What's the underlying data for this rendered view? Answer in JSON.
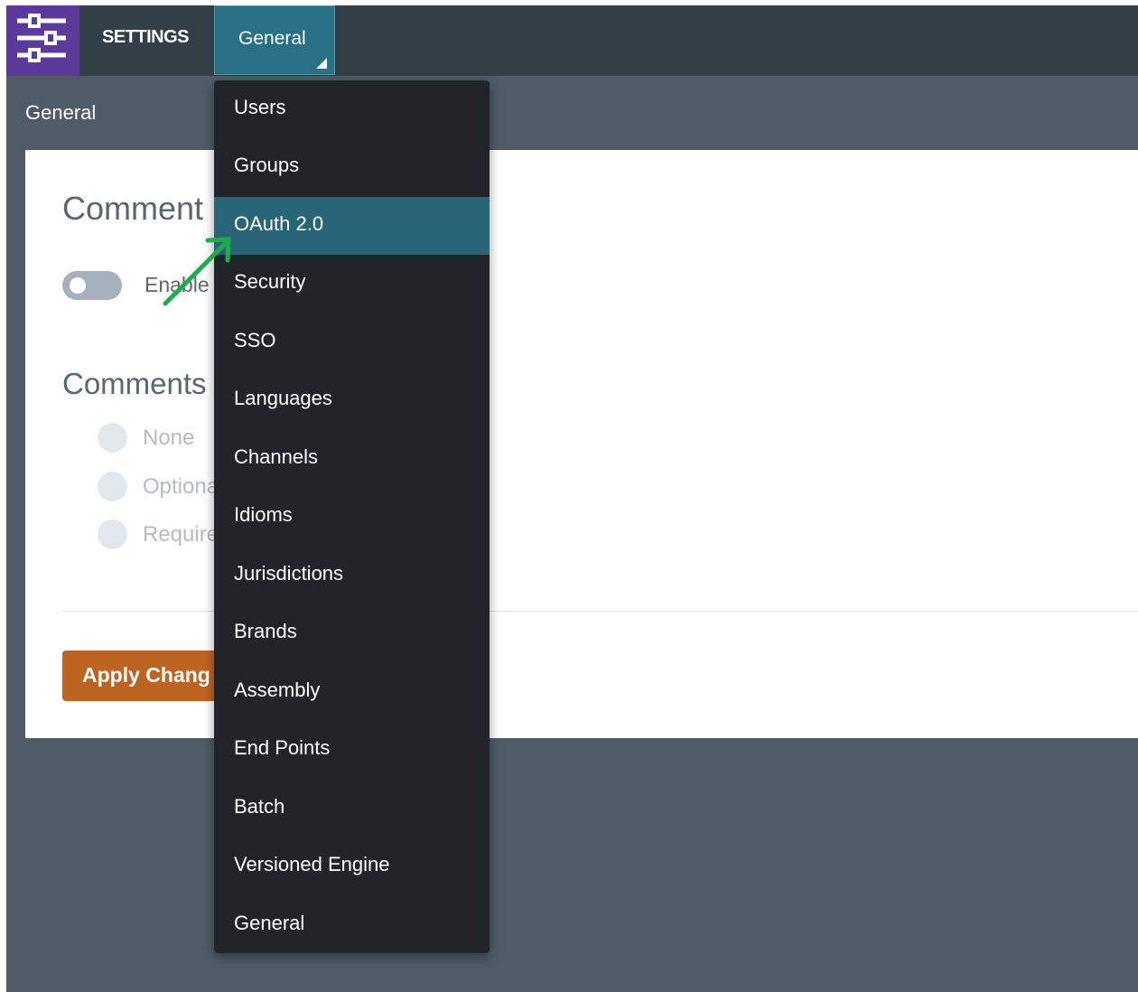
{
  "header": {
    "app_icon": "sliders-icon",
    "title": "SETTINGS",
    "active_tab": "General"
  },
  "breadcrumb": "General",
  "content": {
    "section1_title": "Comment",
    "toggle_label": "Enable",
    "section2_title": "Comments",
    "radio_options": [
      "None",
      "Optiona",
      "Require"
    ],
    "apply_label": "Apply Chang"
  },
  "menu": {
    "items": [
      "Users",
      "Groups",
      "OAuth 2.0",
      "Security",
      "SSO",
      "Languages",
      "Channels",
      "Idioms",
      "Jurisdictions",
      "Brands",
      "Assembly",
      "End Points",
      "Batch",
      "Versioned Engine",
      "General"
    ],
    "highlighted": "OAuth 2.0"
  },
  "colors": {
    "app_icon_bg": "#5b3a9b",
    "tab_active": "#2a7084",
    "menu_bg": "#212529",
    "menu_highlight": "#2a6478",
    "apply_button": "#bd6423",
    "annotation_arrow": "#1faa4c"
  },
  "annotation": {
    "type": "arrow-icon",
    "points_to": "OAuth 2.0"
  }
}
